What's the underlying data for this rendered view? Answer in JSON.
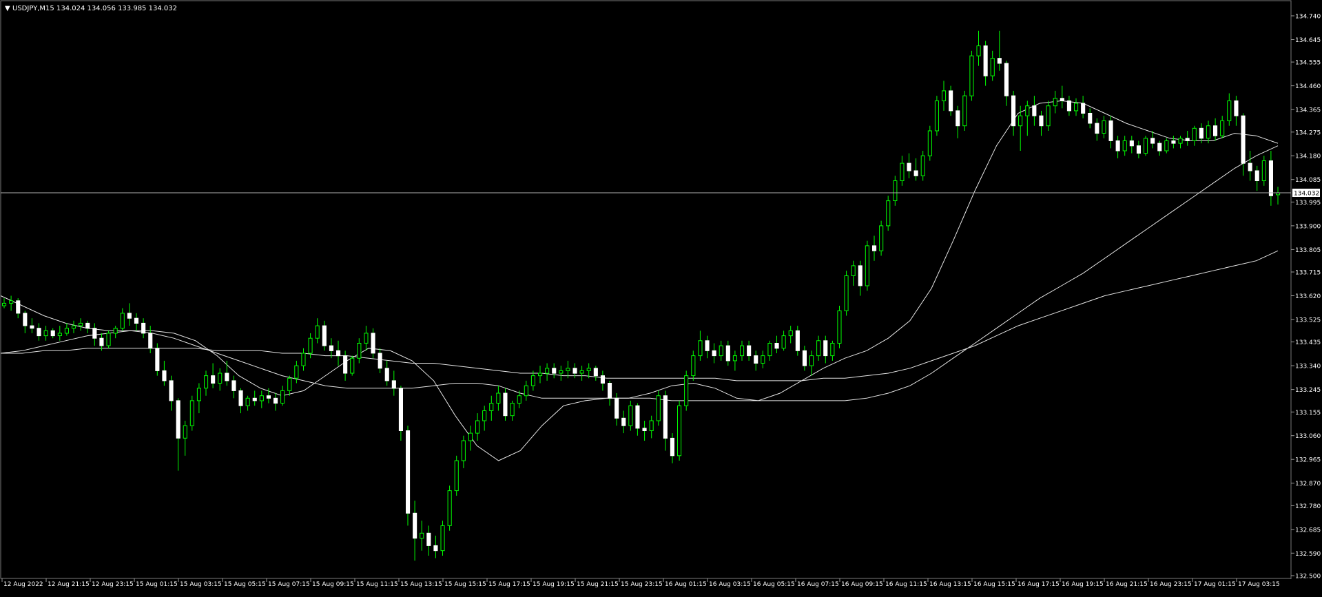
{
  "header": {
    "arrow": "▼",
    "symbol_text": "USDJPY,M15",
    "ohlc_text": "134.024 134.056 133.985 134.032"
  },
  "current_price_label": "134.032",
  "chart_data": {
    "type": "candlestick",
    "symbol": "USDJPY",
    "timeframe": "M15",
    "title": "USDJPY,M15",
    "last_bar": {
      "open": 134.024,
      "high": 134.056,
      "low": 133.985,
      "close": 134.032
    },
    "current_price": 134.032,
    "ylim": [
      132.5,
      134.76
    ],
    "y_ticks": [
      "134.740",
      "134.645",
      "134.555",
      "134.460",
      "134.365",
      "134.275",
      "134.180",
      "134.085",
      "133.995",
      "133.900",
      "133.805",
      "133.715",
      "133.620",
      "133.525",
      "133.435",
      "133.340",
      "133.245",
      "133.155",
      "133.060",
      "132.965",
      "132.870",
      "132.780",
      "132.685",
      "132.590",
      "132.500"
    ],
    "x_ticks": [
      "12 Aug 2022",
      "12 Aug 21:15",
      "12 Aug 23:15",
      "15 Aug 01:15",
      "15 Aug 03:15",
      "15 Aug 05:15",
      "15 Aug 07:15",
      "15 Aug 09:15",
      "15 Aug 11:15",
      "15 Aug 13:15",
      "15 Aug 15:15",
      "15 Aug 17:15",
      "15 Aug 19:15",
      "15 Aug 21:15",
      "15 Aug 23:15",
      "16 Aug 01:15",
      "16 Aug 03:15",
      "16 Aug 05:15",
      "16 Aug 07:15",
      "16 Aug 09:15",
      "16 Aug 11:15",
      "16 Aug 13:15",
      "16 Aug 15:15",
      "16 Aug 17:15",
      "16 Aug 19:15",
      "16 Aug 21:15",
      "16 Aug 23:15",
      "17 Aug 01:15",
      "17 Aug 03:15"
    ],
    "bullish_color": "#00ff00",
    "bearish_body_color": "#ffffff",
    "wick_color": "#00ff00",
    "ma_color": "#e6e6e6",
    "background_color": "#000000",
    "grid": false,
    "candles": [
      [
        133.58,
        133.61,
        133.57,
        133.59
      ],
      [
        133.59,
        133.62,
        133.56,
        133.6
      ],
      [
        133.6,
        133.61,
        133.53,
        133.55
      ],
      [
        133.55,
        133.56,
        133.47,
        133.5
      ],
      [
        133.5,
        133.53,
        133.47,
        133.49
      ],
      [
        133.49,
        133.51,
        133.44,
        133.46
      ],
      [
        133.46,
        133.5,
        133.44,
        133.48
      ],
      [
        133.48,
        133.49,
        133.45,
        133.46
      ],
      [
        133.46,
        133.5,
        133.44,
        133.47
      ],
      [
        133.47,
        133.51,
        133.46,
        133.49
      ],
      [
        133.49,
        133.52,
        133.47,
        133.5
      ],
      [
        133.5,
        133.53,
        133.48,
        133.51
      ],
      [
        133.51,
        133.52,
        133.47,
        133.49
      ],
      [
        133.49,
        133.51,
        133.42,
        133.45
      ],
      [
        133.45,
        133.47,
        133.4,
        133.42
      ],
      [
        133.42,
        133.48,
        133.41,
        133.47
      ],
      [
        133.47,
        133.5,
        133.45,
        133.49
      ],
      [
        133.49,
        133.57,
        133.48,
        133.55
      ],
      [
        133.55,
        133.59,
        133.5,
        133.53
      ],
      [
        133.53,
        133.55,
        133.48,
        133.51
      ],
      [
        133.51,
        133.53,
        133.45,
        133.47
      ],
      [
        133.47,
        133.5,
        133.39,
        133.41
      ],
      [
        133.41,
        133.43,
        133.3,
        133.32
      ],
      [
        133.32,
        133.36,
        133.26,
        133.28
      ],
      [
        133.28,
        133.3,
        133.16,
        133.2
      ],
      [
        133.2,
        133.21,
        132.92,
        133.05
      ],
      [
        133.05,
        133.12,
        132.98,
        133.1
      ],
      [
        133.1,
        133.22,
        133.08,
        133.2
      ],
      [
        133.2,
        133.27,
        133.15,
        133.25
      ],
      [
        133.25,
        133.32,
        133.22,
        133.3
      ],
      [
        133.3,
        133.35,
        133.25,
        133.27
      ],
      [
        133.27,
        133.33,
        133.24,
        133.31
      ],
      [
        133.31,
        133.36,
        133.26,
        133.28
      ],
      [
        133.28,
        133.3,
        133.21,
        133.24
      ],
      [
        133.24,
        133.25,
        133.15,
        133.18
      ],
      [
        133.18,
        133.22,
        133.16,
        133.21
      ],
      [
        133.21,
        133.24,
        133.18,
        133.2
      ],
      [
        133.2,
        133.24,
        133.17,
        133.22
      ],
      [
        133.22,
        133.25,
        133.19,
        133.21
      ],
      [
        133.21,
        133.23,
        133.16,
        133.19
      ],
      [
        133.19,
        133.26,
        133.18,
        133.24
      ],
      [
        133.24,
        133.3,
        133.22,
        133.29
      ],
      [
        133.29,
        133.36,
        133.27,
        133.34
      ],
      [
        133.34,
        133.41,
        133.32,
        133.39
      ],
      [
        133.39,
        133.47,
        133.37,
        133.45
      ],
      [
        133.45,
        133.53,
        133.43,
        133.5
      ],
      [
        133.5,
        133.52,
        133.4,
        133.42
      ],
      [
        133.42,
        133.45,
        133.37,
        133.4
      ],
      [
        133.4,
        133.44,
        133.34,
        133.38
      ],
      [
        133.38,
        133.4,
        133.28,
        133.31
      ],
      [
        133.31,
        133.38,
        133.3,
        133.37
      ],
      [
        133.37,
        133.45,
        133.35,
        133.43
      ],
      [
        133.43,
        133.5,
        133.4,
        133.47
      ],
      [
        133.47,
        133.49,
        133.37,
        133.39
      ],
      [
        133.39,
        133.41,
        133.31,
        133.33
      ],
      [
        133.33,
        133.36,
        133.26,
        133.28
      ],
      [
        133.28,
        133.32,
        133.22,
        133.25
      ],
      [
        133.25,
        133.26,
        133.04,
        133.08
      ],
      [
        133.08,
        133.1,
        132.7,
        132.75
      ],
      [
        132.75,
        132.8,
        132.56,
        132.65
      ],
      [
        132.65,
        132.72,
        132.6,
        132.67
      ],
      [
        132.67,
        132.7,
        132.58,
        132.62
      ],
      [
        132.62,
        132.66,
        132.57,
        132.6
      ],
      [
        132.6,
        132.72,
        132.58,
        132.7
      ],
      [
        132.7,
        132.86,
        132.68,
        132.84
      ],
      [
        132.84,
        132.98,
        132.82,
        132.96
      ],
      [
        132.96,
        133.06,
        132.93,
        133.04
      ],
      [
        133.04,
        133.1,
        133.0,
        133.07
      ],
      [
        133.07,
        133.15,
        133.04,
        133.12
      ],
      [
        133.12,
        133.18,
        133.08,
        133.16
      ],
      [
        133.16,
        133.22,
        133.12,
        133.19
      ],
      [
        133.19,
        133.26,
        133.16,
        133.23
      ],
      [
        133.23,
        133.25,
        133.12,
        133.14
      ],
      [
        133.14,
        133.2,
        133.12,
        133.19
      ],
      [
        133.19,
        133.24,
        133.17,
        133.22
      ],
      [
        133.22,
        133.28,
        133.2,
        133.26
      ],
      [
        133.26,
        133.32,
        133.24,
        133.3
      ],
      [
        133.3,
        133.34,
        133.27,
        133.31
      ],
      [
        133.31,
        133.35,
        133.28,
        133.33
      ],
      [
        133.33,
        133.35,
        133.29,
        133.31
      ],
      [
        133.31,
        133.34,
        133.28,
        133.32
      ],
      [
        133.32,
        133.36,
        133.29,
        133.33
      ],
      [
        133.33,
        133.35,
        133.29,
        133.31
      ],
      [
        133.31,
        133.34,
        133.28,
        133.32
      ],
      [
        133.32,
        133.35,
        133.29,
        133.33
      ],
      [
        133.33,
        133.34,
        133.28,
        133.3
      ],
      [
        133.3,
        133.32,
        133.24,
        133.27
      ],
      [
        133.27,
        133.28,
        133.18,
        133.21
      ],
      [
        133.21,
        133.23,
        133.1,
        133.13
      ],
      [
        133.13,
        133.16,
        133.07,
        133.1
      ],
      [
        133.1,
        133.2,
        133.08,
        133.18
      ],
      [
        133.18,
        133.19,
        133.06,
        133.09
      ],
      [
        133.09,
        133.12,
        133.04,
        133.08
      ],
      [
        133.08,
        133.14,
        133.05,
        133.12
      ],
      [
        133.12,
        133.24,
        133.1,
        133.22
      ],
      [
        133.22,
        133.24,
        133.0,
        133.05
      ],
      [
        133.05,
        133.07,
        132.95,
        132.98
      ],
      [
        132.98,
        133.2,
        132.96,
        133.18
      ],
      [
        133.18,
        133.32,
        133.16,
        133.3
      ],
      [
        133.3,
        133.4,
        133.28,
        133.38
      ],
      [
        133.38,
        133.48,
        133.36,
        133.44
      ],
      [
        133.44,
        133.46,
        133.37,
        133.4
      ],
      [
        133.4,
        133.43,
        133.35,
        133.38
      ],
      [
        133.38,
        133.44,
        133.36,
        133.42
      ],
      [
        133.42,
        133.44,
        133.34,
        133.36
      ],
      [
        133.36,
        133.4,
        133.32,
        133.38
      ],
      [
        133.38,
        133.44,
        133.36,
        133.42
      ],
      [
        133.42,
        133.44,
        133.36,
        133.38
      ],
      [
        133.38,
        133.4,
        133.32,
        133.35
      ],
      [
        133.35,
        133.4,
        133.33,
        133.38
      ],
      [
        133.38,
        133.44,
        133.36,
        133.43
      ],
      [
        133.43,
        133.46,
        133.39,
        133.41
      ],
      [
        133.41,
        133.48,
        133.4,
        133.46
      ],
      [
        133.46,
        133.5,
        133.43,
        133.48
      ],
      [
        133.48,
        133.5,
        133.38,
        133.4
      ],
      [
        133.4,
        133.42,
        133.32,
        133.34
      ],
      [
        133.34,
        133.4,
        133.3,
        133.38
      ],
      [
        133.38,
        133.46,
        133.36,
        133.44
      ],
      [
        133.44,
        133.46,
        133.35,
        133.38
      ],
      [
        133.38,
        133.44,
        133.36,
        133.43
      ],
      [
        133.43,
        133.58,
        133.41,
        133.56
      ],
      [
        133.56,
        133.72,
        133.54,
        133.7
      ],
      [
        133.7,
        133.76,
        133.66,
        133.74
      ],
      [
        133.74,
        133.76,
        133.62,
        133.66
      ],
      [
        133.66,
        133.84,
        133.64,
        133.82
      ],
      [
        133.82,
        133.86,
        133.76,
        133.8
      ],
      [
        133.8,
        133.92,
        133.78,
        133.9
      ],
      [
        133.9,
        134.02,
        133.88,
        134.0
      ],
      [
        134.0,
        134.1,
        133.98,
        134.08
      ],
      [
        134.08,
        134.18,
        134.06,
        134.15
      ],
      [
        134.15,
        134.19,
        134.09,
        134.12
      ],
      [
        134.12,
        134.17,
        134.08,
        134.1
      ],
      [
        134.1,
        134.2,
        134.08,
        134.18
      ],
      [
        134.18,
        134.3,
        134.16,
        134.28
      ],
      [
        134.28,
        134.42,
        134.26,
        134.4
      ],
      [
        134.4,
        134.48,
        134.36,
        134.44
      ],
      [
        134.44,
        134.46,
        134.34,
        134.36
      ],
      [
        134.36,
        134.38,
        134.25,
        134.3
      ],
      [
        134.3,
        134.44,
        134.28,
        134.42
      ],
      [
        134.42,
        134.6,
        134.4,
        134.58
      ],
      [
        134.58,
        134.68,
        134.54,
        134.62
      ],
      [
        134.62,
        134.64,
        134.46,
        134.5
      ],
      [
        134.5,
        134.6,
        134.48,
        134.57
      ],
      [
        134.57,
        134.68,
        134.52,
        134.55
      ],
      [
        134.55,
        134.56,
        134.38,
        134.42
      ],
      [
        134.42,
        134.44,
        134.26,
        134.3
      ],
      [
        134.3,
        134.38,
        134.2,
        134.34
      ],
      [
        134.34,
        134.4,
        134.26,
        134.38
      ],
      [
        134.38,
        134.42,
        134.3,
        134.34
      ],
      [
        134.34,
        134.36,
        134.26,
        134.3
      ],
      [
        134.3,
        134.4,
        134.28,
        134.38
      ],
      [
        134.38,
        134.44,
        134.35,
        134.41
      ],
      [
        134.41,
        134.46,
        134.37,
        134.4
      ],
      [
        134.4,
        134.42,
        134.34,
        134.36
      ],
      [
        134.36,
        134.41,
        134.34,
        134.39
      ],
      [
        134.39,
        134.42,
        134.33,
        134.35
      ],
      [
        134.35,
        134.37,
        134.29,
        134.31
      ],
      [
        134.31,
        134.33,
        134.24,
        134.27
      ],
      [
        134.27,
        134.34,
        134.25,
        134.32
      ],
      [
        134.32,
        134.34,
        134.21,
        134.24
      ],
      [
        134.24,
        134.26,
        134.17,
        134.2
      ],
      [
        134.2,
        134.26,
        134.18,
        134.24
      ],
      [
        134.24,
        134.26,
        134.19,
        134.22
      ],
      [
        134.22,
        134.24,
        134.17,
        134.19
      ],
      [
        134.19,
        134.26,
        134.18,
        134.25
      ],
      [
        134.25,
        134.28,
        134.21,
        134.23
      ],
      [
        134.23,
        134.24,
        134.18,
        134.2
      ],
      [
        134.2,
        134.25,
        134.19,
        134.24
      ],
      [
        134.24,
        134.26,
        134.21,
        134.23
      ],
      [
        134.23,
        134.26,
        134.21,
        134.25
      ],
      [
        134.25,
        134.28,
        134.22,
        134.24
      ],
      [
        134.24,
        134.3,
        134.22,
        134.29
      ],
      [
        134.29,
        134.31,
        134.23,
        134.25
      ],
      [
        134.25,
        134.32,
        134.23,
        134.3
      ],
      [
        134.3,
        134.33,
        134.24,
        134.26
      ],
      [
        134.26,
        134.34,
        134.25,
        134.32
      ],
      [
        134.32,
        134.43,
        134.3,
        134.4
      ],
      [
        134.4,
        134.42,
        134.3,
        134.34
      ],
      [
        134.34,
        134.35,
        134.1,
        134.15
      ],
      [
        134.15,
        134.2,
        134.08,
        134.12
      ],
      [
        134.12,
        134.14,
        134.04,
        134.08
      ],
      [
        134.08,
        134.18,
        134.06,
        134.16
      ],
      [
        134.16,
        134.2,
        133.98,
        134.02
      ],
      [
        134.024,
        134.056,
        133.985,
        134.032
      ]
    ],
    "moving_averages": [
      {
        "points": [
          133.39,
          133.4,
          133.42,
          133.44,
          133.46,
          133.47,
          133.48,
          133.48,
          133.47,
          133.44,
          133.38,
          133.3,
          133.25,
          133.22,
          133.24,
          133.3,
          133.36,
          133.41,
          133.4,
          133.36,
          133.28,
          133.14,
          133.02,
          132.96,
          133.0,
          133.1,
          133.18,
          133.2,
          133.21,
          133.21,
          133.23,
          133.26,
          133.27,
          133.25,
          133.21,
          133.2,
          133.23,
          133.28,
          133.33,
          133.37,
          133.4,
          133.45,
          133.52,
          133.65,
          133.84,
          134.04,
          134.22,
          134.35,
          134.39,
          134.4,
          134.39,
          134.35,
          134.31,
          134.28,
          134.25,
          134.24,
          134.24,
          134.27,
          134.26,
          134.23
        ]
      },
      {
        "points": [
          133.62,
          133.58,
          133.54,
          133.51,
          133.49,
          133.48,
          133.48,
          133.47,
          133.45,
          133.42,
          133.39,
          133.36,
          133.33,
          133.3,
          133.28,
          133.26,
          133.25,
          133.25,
          133.25,
          133.25,
          133.26,
          133.27,
          133.27,
          133.26,
          133.23,
          133.21,
          133.21,
          133.21,
          133.21,
          133.21,
          133.21,
          133.2,
          133.2,
          133.2,
          133.2,
          133.2,
          133.2,
          133.2,
          133.2,
          133.2,
          133.21,
          133.23,
          133.26,
          133.31,
          133.37,
          133.43,
          133.49,
          133.55,
          133.61,
          133.66,
          133.71,
          133.77,
          133.83,
          133.89,
          133.95,
          134.01,
          134.07,
          134.13,
          134.18,
          134.22
        ]
      },
      {
        "points": [
          133.39,
          133.39,
          133.4,
          133.4,
          133.41,
          133.41,
          133.41,
          133.41,
          133.41,
          133.41,
          133.4,
          133.4,
          133.4,
          133.39,
          133.39,
          133.38,
          133.38,
          133.37,
          133.36,
          133.35,
          133.35,
          133.34,
          133.33,
          133.32,
          133.31,
          133.31,
          133.3,
          133.3,
          133.29,
          133.29,
          133.29,
          133.29,
          133.29,
          133.29,
          133.28,
          133.28,
          133.28,
          133.28,
          133.29,
          133.29,
          133.3,
          133.31,
          133.33,
          133.36,
          133.39,
          133.42,
          133.46,
          133.5,
          133.53,
          133.56,
          133.59,
          133.62,
          133.64,
          133.66,
          133.68,
          133.7,
          133.72,
          133.74,
          133.76,
          133.8
        ]
      }
    ]
  }
}
